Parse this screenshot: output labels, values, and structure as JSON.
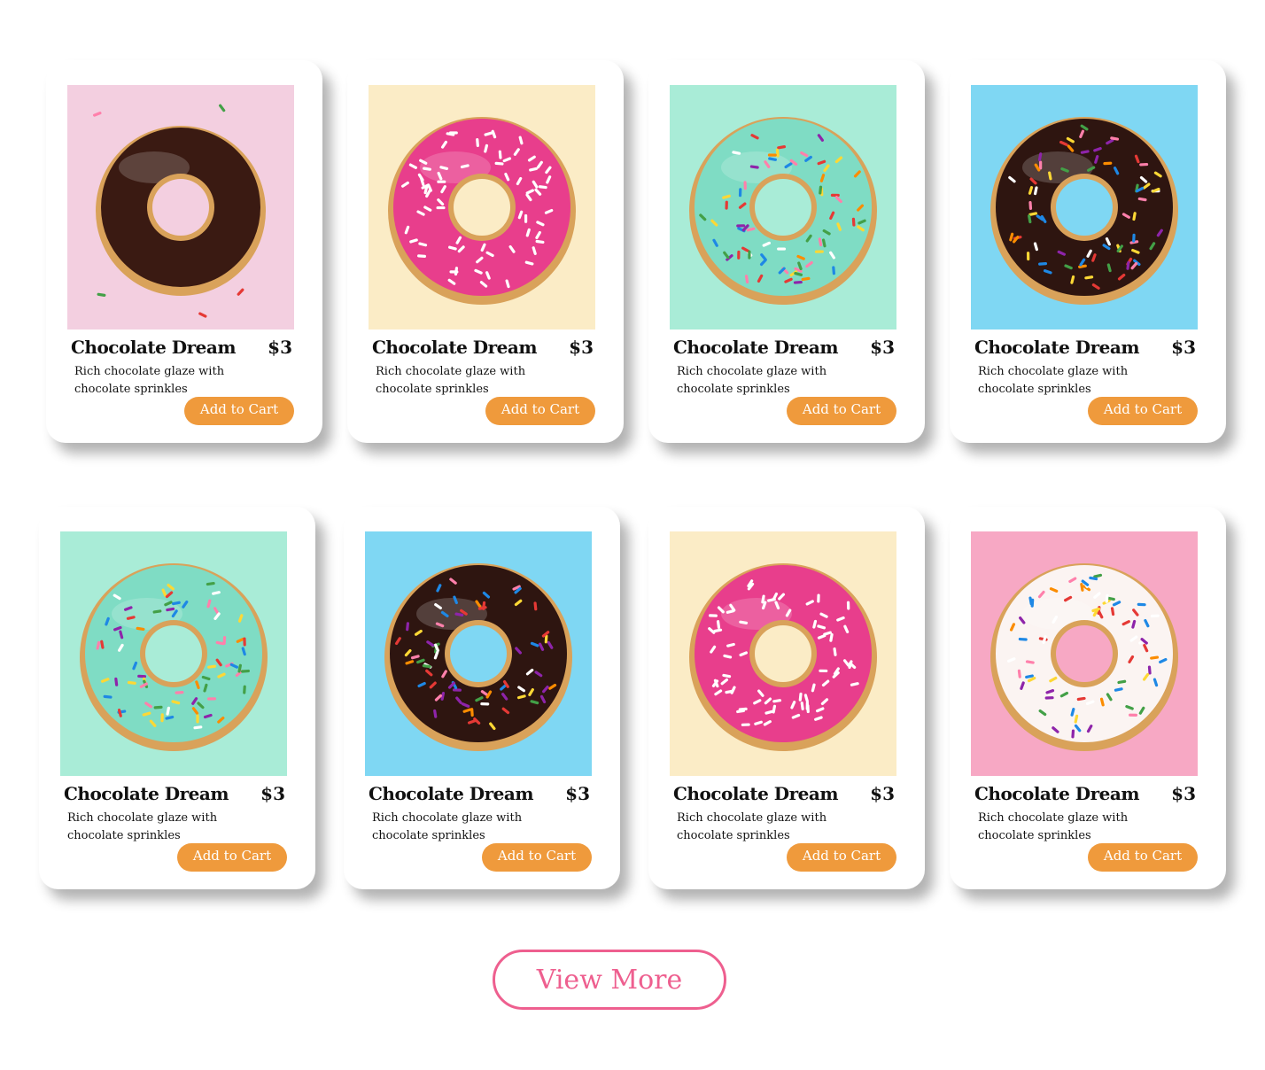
{
  "products": [
    {
      "name": "Chocolate Dream",
      "price": "$3",
      "description": "Rich chocolate glaze with chocolate sprinkles",
      "button_label": "Add to Cart",
      "image": "chocolate-donut-pink-background",
      "bg_color": "#f3cfe0",
      "glaze_color": "#3a1a12",
      "sprinkles": "few"
    },
    {
      "name": "Chocolate Dream",
      "price": "$3",
      "description": "Rich chocolate glaze with chocolate sprinkles",
      "button_label": "Add to Cart",
      "image": "pink-donut-yellow-background",
      "bg_color": "#fbecc6",
      "glaze_color": "#e83e8c",
      "sprinkles": "white"
    },
    {
      "name": "Chocolate Dream",
      "price": "$3",
      "description": "Rich chocolate glaze with chocolate sprinkles",
      "button_label": "Add to Cart",
      "image": "mint-donut-mint-background",
      "bg_color": "#a9ecd7",
      "glaze_color": "#7fdcc4",
      "sprinkles": "rainbow"
    },
    {
      "name": "Chocolate Dream",
      "price": "$3",
      "description": "Rich chocolate glaze with chocolate sprinkles",
      "button_label": "Add to Cart",
      "image": "chocolate-donut-blue-background",
      "bg_color": "#7fd7f3",
      "glaze_color": "#2e1510",
      "sprinkles": "rainbow"
    },
    {
      "name": "Chocolate Dream",
      "price": "$3",
      "description": "Rich chocolate glaze with chocolate sprinkles",
      "button_label": "Add to Cart",
      "image": "mint-donut-mint-background",
      "bg_color": "#a9ecd7",
      "glaze_color": "#7fdcc4",
      "sprinkles": "rainbow"
    },
    {
      "name": "Chocolate Dream",
      "price": "$3",
      "description": "Rich chocolate glaze with chocolate sprinkles",
      "button_label": "Add to Cart",
      "image": "chocolate-donut-blue-background",
      "bg_color": "#7fd7f3",
      "glaze_color": "#2e1510",
      "sprinkles": "rainbow"
    },
    {
      "name": "Chocolate Dream",
      "price": "$3",
      "description": "Rich chocolate glaze with chocolate sprinkles",
      "button_label": "Add to Cart",
      "image": "pink-donut-yellow-background",
      "bg_color": "#fbecc6",
      "glaze_color": "#e83e8c",
      "sprinkles": "white"
    },
    {
      "name": "Chocolate Dream",
      "price": "$3",
      "description": "Rich chocolate glaze with chocolate sprinkles",
      "button_label": "Add to Cart",
      "image": "white-donut-pink-background",
      "bg_color": "#f7a8c4",
      "glaze_color": "#fbf4f2",
      "sprinkles": "rainbow"
    }
  ],
  "view_more": {
    "label": "View More"
  },
  "colors": {
    "accent": "#ef9a3c",
    "view_more": "#ee5f8f"
  }
}
